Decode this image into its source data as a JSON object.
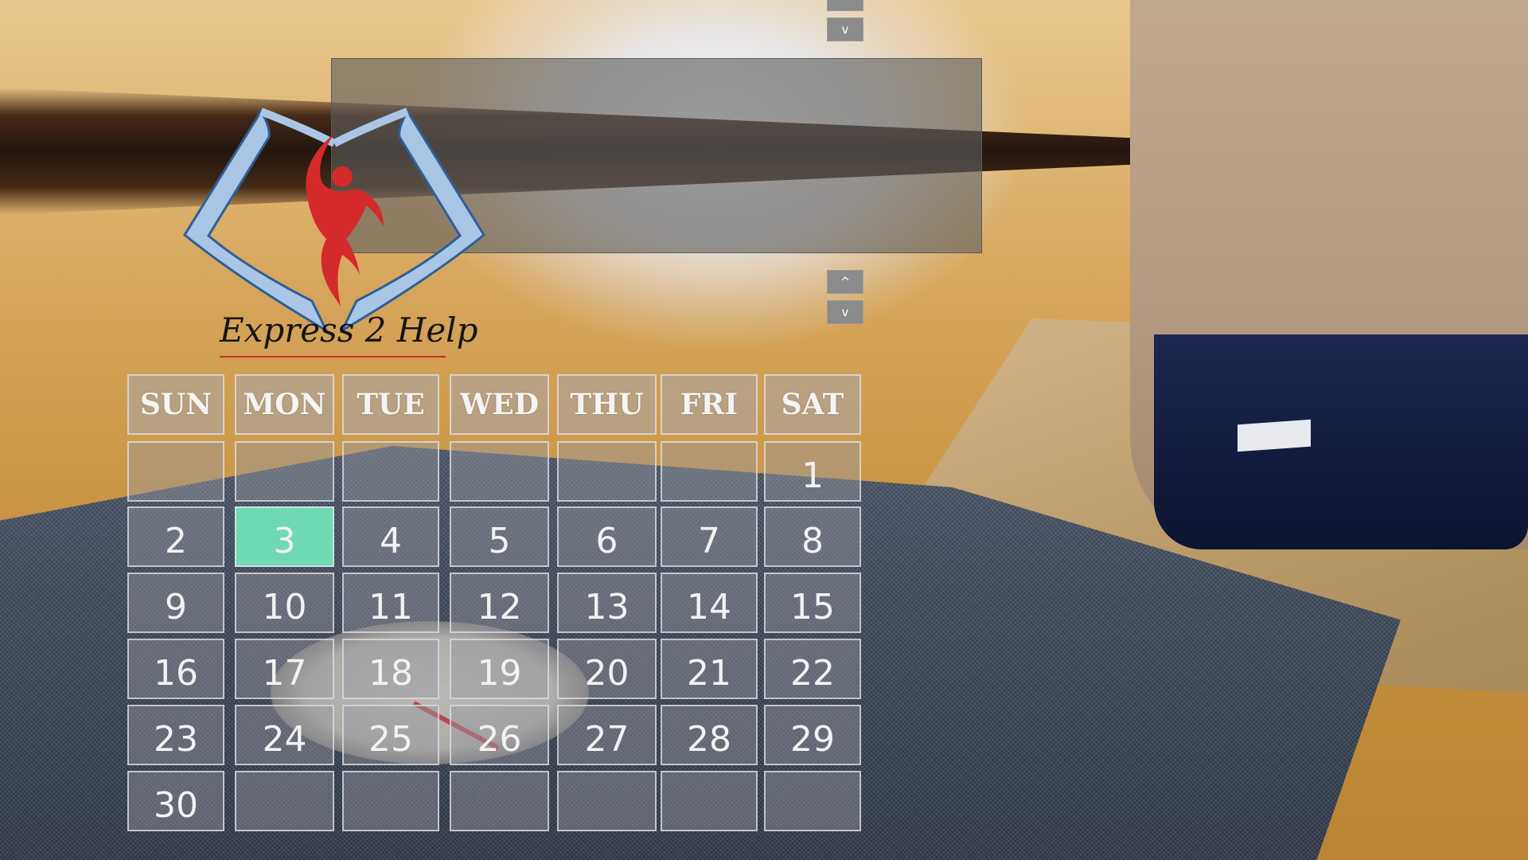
{
  "spinners": {
    "top_up_icon": "^",
    "top_down_icon": "v",
    "mid_up_icon": "^",
    "mid_down_icon": "v"
  },
  "logo": {
    "text": "Express 2 Help",
    "colors": {
      "frame": "#a9c6e6",
      "frame_outline": "#2f5f97",
      "figure": "#d42a2a",
      "underline": "#c9302f"
    }
  },
  "calendar": {
    "weekdays": [
      "SUN",
      "MON",
      "TUE",
      "WED",
      "THU",
      "FRI",
      "SAT"
    ],
    "weeks": [
      [
        "",
        "",
        "",
        "",
        "",
        "",
        "1"
      ],
      [
        "2",
        "3",
        "4",
        "5",
        "6",
        "7",
        "8"
      ],
      [
        "9",
        "10",
        "11",
        "12",
        "13",
        "14",
        "15"
      ],
      [
        "16",
        "17",
        "18",
        "19",
        "20",
        "21",
        "22"
      ],
      [
        "23",
        "24",
        "25",
        "26",
        "27",
        "28",
        "29"
      ],
      [
        "30",
        "",
        "",
        "",
        "",
        "",
        ""
      ]
    ],
    "selected_day": "3",
    "selected_color": "#6fd9b4"
  }
}
